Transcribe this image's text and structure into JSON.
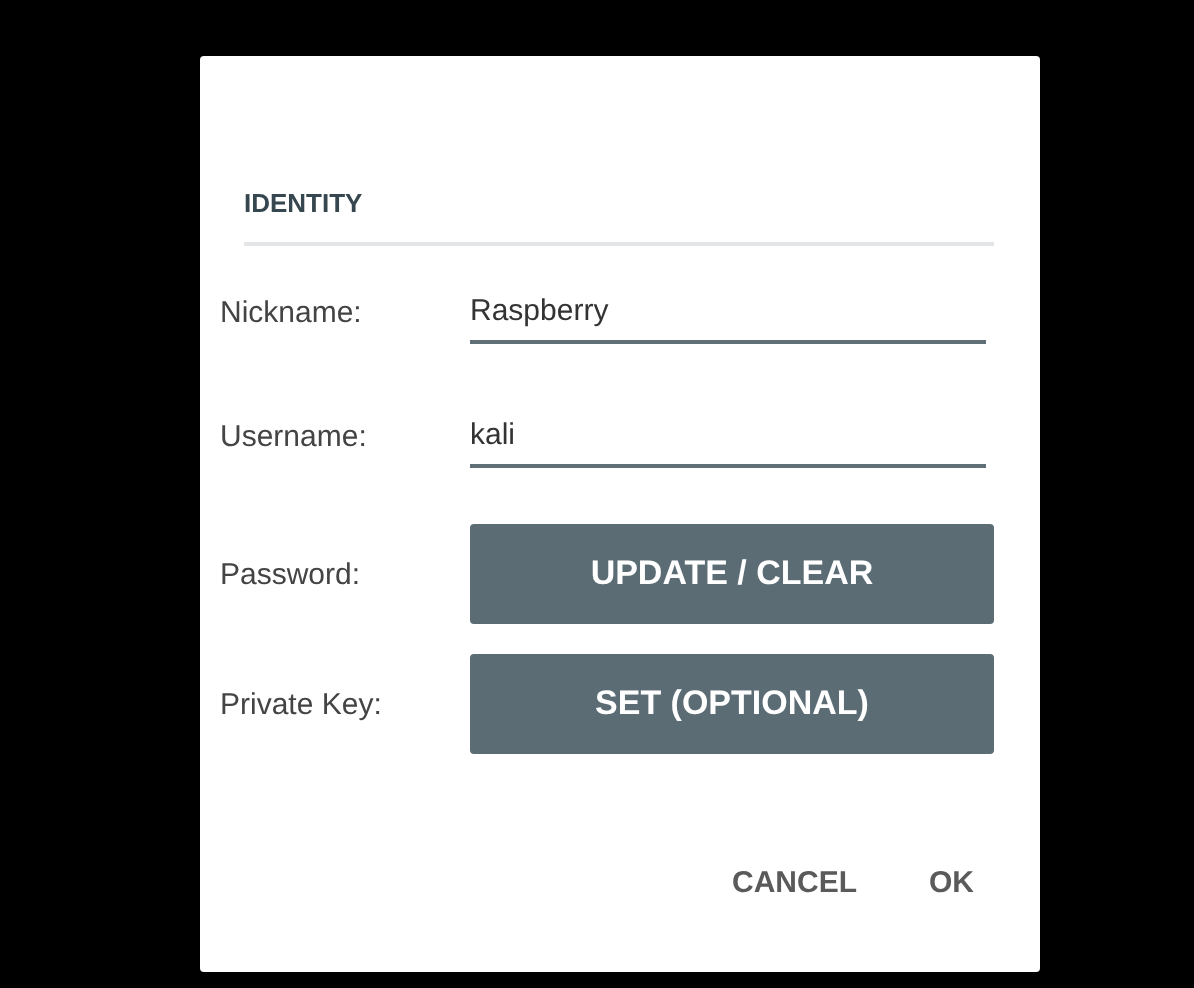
{
  "dialog": {
    "section_title": "IDENTITY",
    "rows": [
      {
        "kind": "field",
        "label": "Nickname:",
        "value": "Raspberry"
      },
      {
        "kind": "field",
        "label": "Username:",
        "value": "kali"
      },
      {
        "kind": "button",
        "label": "Password:",
        "button": "UPDATE / CLEAR"
      },
      {
        "kind": "button",
        "label": "Private Key:",
        "button": "SET (OPTIONAL)"
      }
    ],
    "actions": [
      "CANCEL",
      "OK"
    ]
  }
}
